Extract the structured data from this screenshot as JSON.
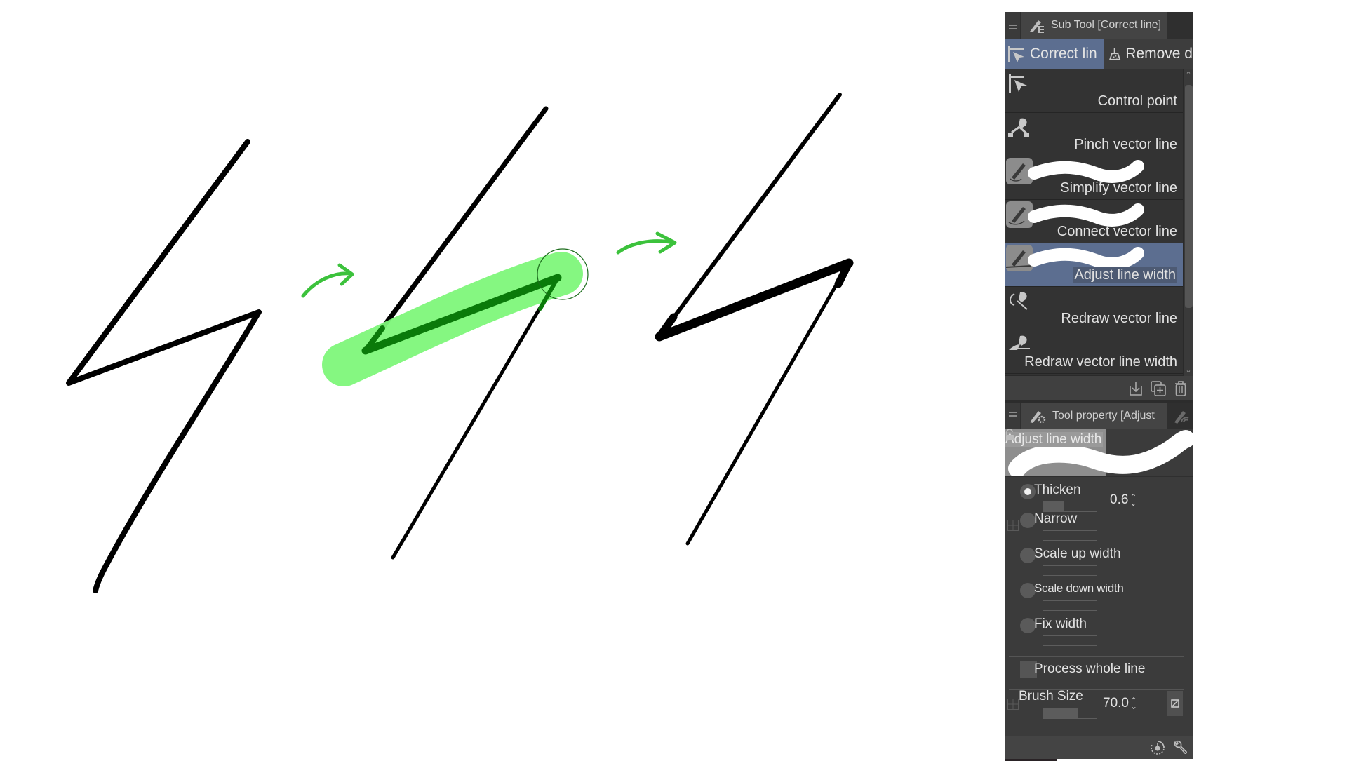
{
  "colors": {
    "accent_selected": "#5c6e90",
    "panel_bg": "#3b3b3b",
    "stroke": "#000000",
    "highlight_green": "#7ef77a",
    "adjusted_line_green": "#0a7a0a",
    "arrow_green": "#3cc23c"
  },
  "canvas": {
    "steps": [
      {
        "name": "original-stroke",
        "description": "Original vector line (lightning bolt)"
      },
      {
        "name": "adjusting-stroke",
        "description": "Adjust line width brush applied over middle segment"
      },
      {
        "name": "result-stroke",
        "description": "Middle segment thickened"
      }
    ],
    "arrows": [
      "step-arrow-1",
      "step-arrow-2"
    ]
  },
  "subtool_panel": {
    "menu_icon": "hamburger-icon",
    "title": "Sub Tool [Correct line]",
    "title_icon": "correct-line-pen-icon",
    "tabs": [
      {
        "label": "Correct lin",
        "icon": "control-point-icon",
        "active": true
      },
      {
        "label": "Remove d",
        "icon": "dustpan-icon",
        "active": false
      }
    ],
    "tools": [
      {
        "label": "Control point",
        "icon": "control-point-icon",
        "selected": false,
        "has_preview": false
      },
      {
        "label": "Pinch vector line",
        "icon": "pinch-vector-icon",
        "selected": false,
        "has_preview": false
      },
      {
        "label": "Simplify vector line",
        "icon": "pen-icon",
        "selected": false,
        "has_preview": true
      },
      {
        "label": "Connect vector line",
        "icon": "pen-icon",
        "selected": false,
        "has_preview": true
      },
      {
        "label": "Adjust line width",
        "icon": "pen-icon",
        "selected": true,
        "has_preview": true
      },
      {
        "label": "Redraw vector line",
        "icon": "redraw-vector-icon",
        "selected": false,
        "has_preview": false
      },
      {
        "label": "Redraw vector line width",
        "icon": "redraw-width-icon",
        "selected": false,
        "has_preview": false
      }
    ],
    "footer_buttons": [
      {
        "name": "import-subtool-button",
        "icon": "import-icon"
      },
      {
        "name": "duplicate-subtool-button",
        "icon": "duplicate-icon"
      },
      {
        "name": "delete-subtool-button",
        "icon": "trash-icon"
      }
    ]
  },
  "tool_property_panel": {
    "title": "Tool property [Adjust",
    "title_icon": "tool-property-icon",
    "brush_size_icon": "brush-size-icon",
    "preview_name": "Adjust line width",
    "options": [
      {
        "label": "Thicken",
        "checked": true,
        "value": "0.6",
        "slider_fraction": 0.38
      },
      {
        "label": "Narrow",
        "checked": false
      },
      {
        "label": "Scale up width",
        "checked": false
      },
      {
        "label": "Scale down width",
        "checked": false
      },
      {
        "label": "Fix width",
        "checked": false
      }
    ],
    "process_whole_line": {
      "label": "Process whole line",
      "checked": false
    },
    "brush_size": {
      "label": "Brush Size",
      "value": "70.0",
      "slider_fraction": 0.65
    },
    "footer_buttons": [
      {
        "name": "initial-settings-button",
        "icon": "dial-icon"
      },
      {
        "name": "tool-settings-button",
        "icon": "wrench-icon"
      }
    ]
  }
}
